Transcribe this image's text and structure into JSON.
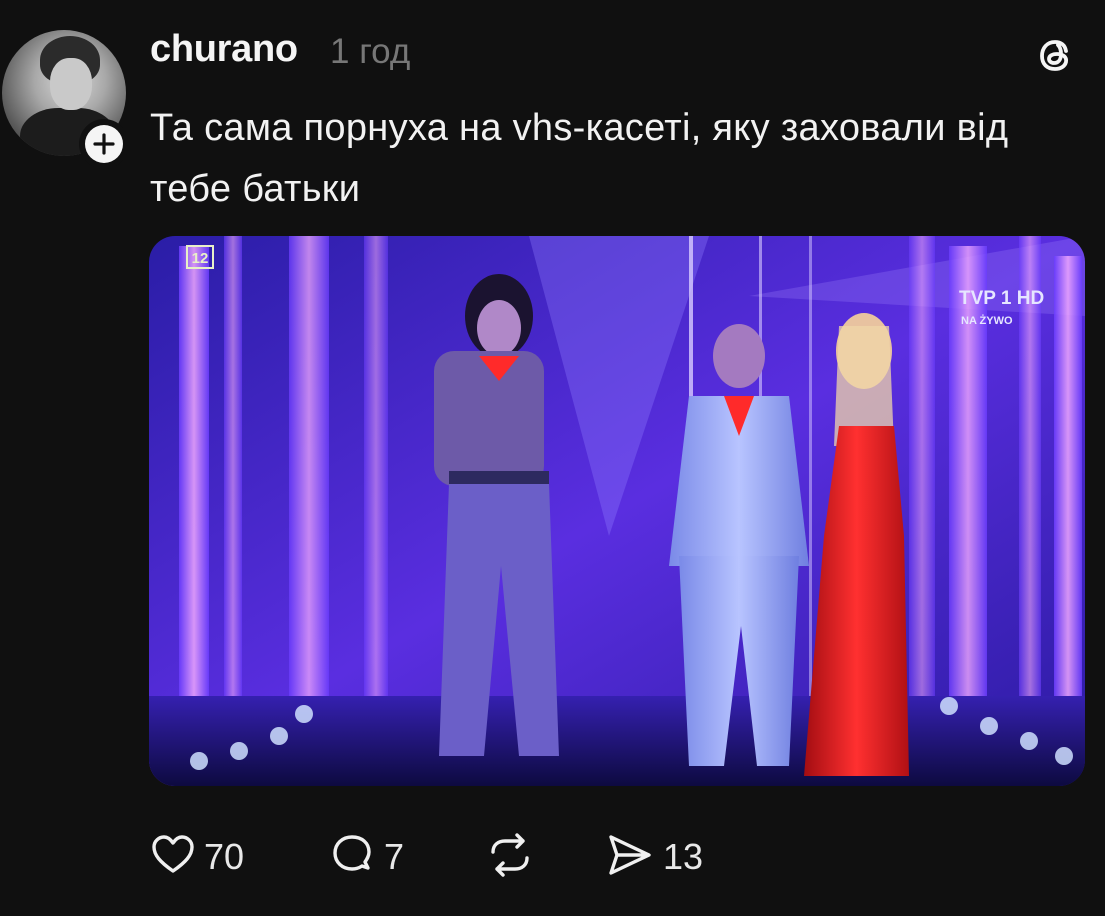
{
  "post": {
    "author": "churano",
    "time": "1 год",
    "text": "Та сама порнуха на vhs-касеті, яку заховали від тебе батьки"
  },
  "media": {
    "channel_corner_badge": "12",
    "broadcaster_logo": "TVP 1 HD",
    "live_label": "NA ŻYWO",
    "dominant_colors": [
      "#3b1fbf",
      "#7a3cff",
      "#e21a1a"
    ]
  },
  "actions": {
    "likes": "70",
    "replies": "7",
    "reposts": "",
    "shares": "13"
  },
  "icons": [
    "threads-logo-icon",
    "plus-icon",
    "heart-icon",
    "comment-icon",
    "repost-icon",
    "share-icon"
  ]
}
